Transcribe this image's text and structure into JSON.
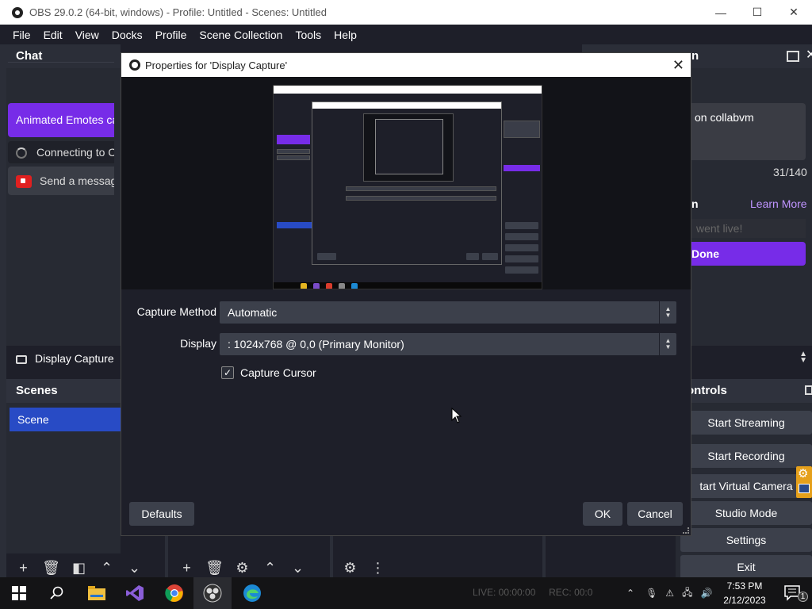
{
  "window": {
    "title": "OBS 29.0.2 (64-bit, windows) - Profile: Untitled - Scenes: Untitled",
    "minimize": "—",
    "maximize": "☐",
    "close": "✕"
  },
  "menu": [
    "File",
    "Edit",
    "View",
    "Docks",
    "Profile",
    "Scene Collection",
    "Tools",
    "Help"
  ],
  "chat": {
    "title": "Chat",
    "emote_banner": "Animated Emotes ca",
    "connecting": "Connecting to C",
    "send_message": "Send a messag"
  },
  "sources": {
    "item": "Display Capture"
  },
  "scenes": {
    "title": "Scenes",
    "item": "Scene"
  },
  "right_dock": {
    "title_fragment": "n",
    "collab_text": "on collabvm",
    "counter": "31/140",
    "label_fragment": "n",
    "learn_more": "Learn More",
    "went_live": "went live!",
    "done": "Done"
  },
  "controls": {
    "title": "ontrols",
    "buttons": [
      "Start Streaming",
      "Start Recording",
      "tart Virtual Camera",
      "Studio Mode",
      "Settings",
      "Exit"
    ]
  },
  "dialog": {
    "title": "Properties for 'Display Capture'",
    "capture_method_label": "Capture Method",
    "capture_method_value": "Automatic",
    "display_label": "Display",
    "display_value": ": 1024x768 @ 0,0 (Primary Monitor)",
    "capture_cursor_label": "Capture Cursor",
    "capture_cursor_checked": true,
    "defaults": "Defaults",
    "ok": "OK",
    "cancel": "Cancel"
  },
  "status": {
    "live": "LIVE: 00:00:00",
    "rec": "REC: 00:0"
  },
  "taskbar": {
    "time": "7:53 PM",
    "date": "2/12/2023",
    "notification_count": "1"
  },
  "colors": {
    "accent_purple": "#772ce8",
    "scene_selected": "#284bc5",
    "button_bg": "#3c404b",
    "panel_bg": "#272a33",
    "window_bg": "#1e1f29",
    "link_purple": "#bf94ff"
  }
}
